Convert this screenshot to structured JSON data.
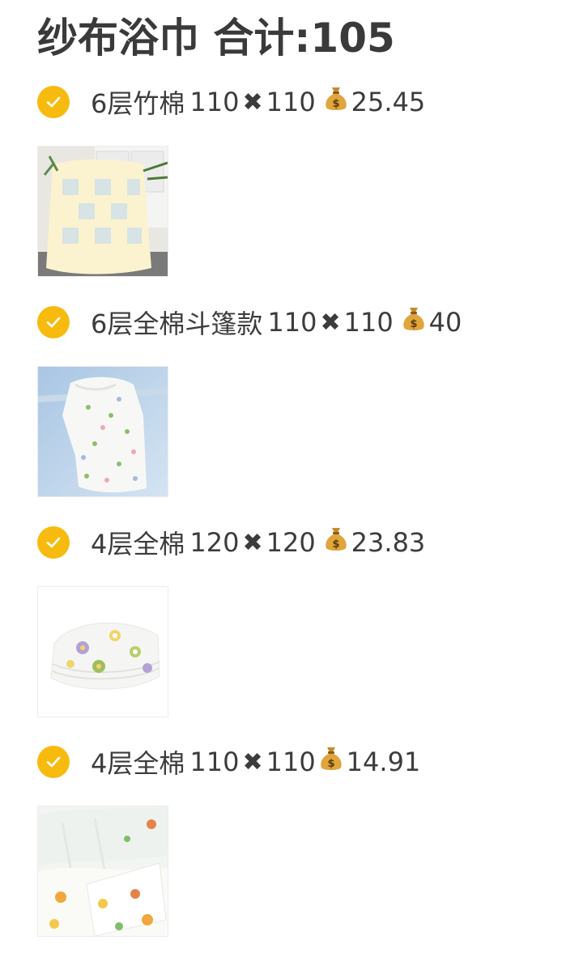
{
  "header": {
    "title": "纱布浴巾 合计:105"
  },
  "colors": {
    "check": "#f7bb0f",
    "text": "#3c3c3c"
  },
  "items": [
    {
      "name": "6层竹棉",
      "size_a": "110",
      "times": "✖",
      "size_b": "110",
      "price": "25.45",
      "checked": true,
      "icon": "money-bag-icon"
    },
    {
      "name": "6层全棉斗篷款",
      "size_a": "110",
      "times": "✖",
      "size_b": "110",
      "price": "40",
      "checked": true,
      "icon": "money-bag-icon"
    },
    {
      "name": "4层全棉",
      "size_a": "120",
      "times": "✖",
      "size_b": "120",
      "price": "23.83",
      "checked": true,
      "icon": "money-bag-icon"
    },
    {
      "name": "4层全棉",
      "size_a": "110",
      "times": "✖",
      "size_b": "110",
      "price": "14.91",
      "checked": true,
      "icon": "money-bag-icon"
    }
  ]
}
